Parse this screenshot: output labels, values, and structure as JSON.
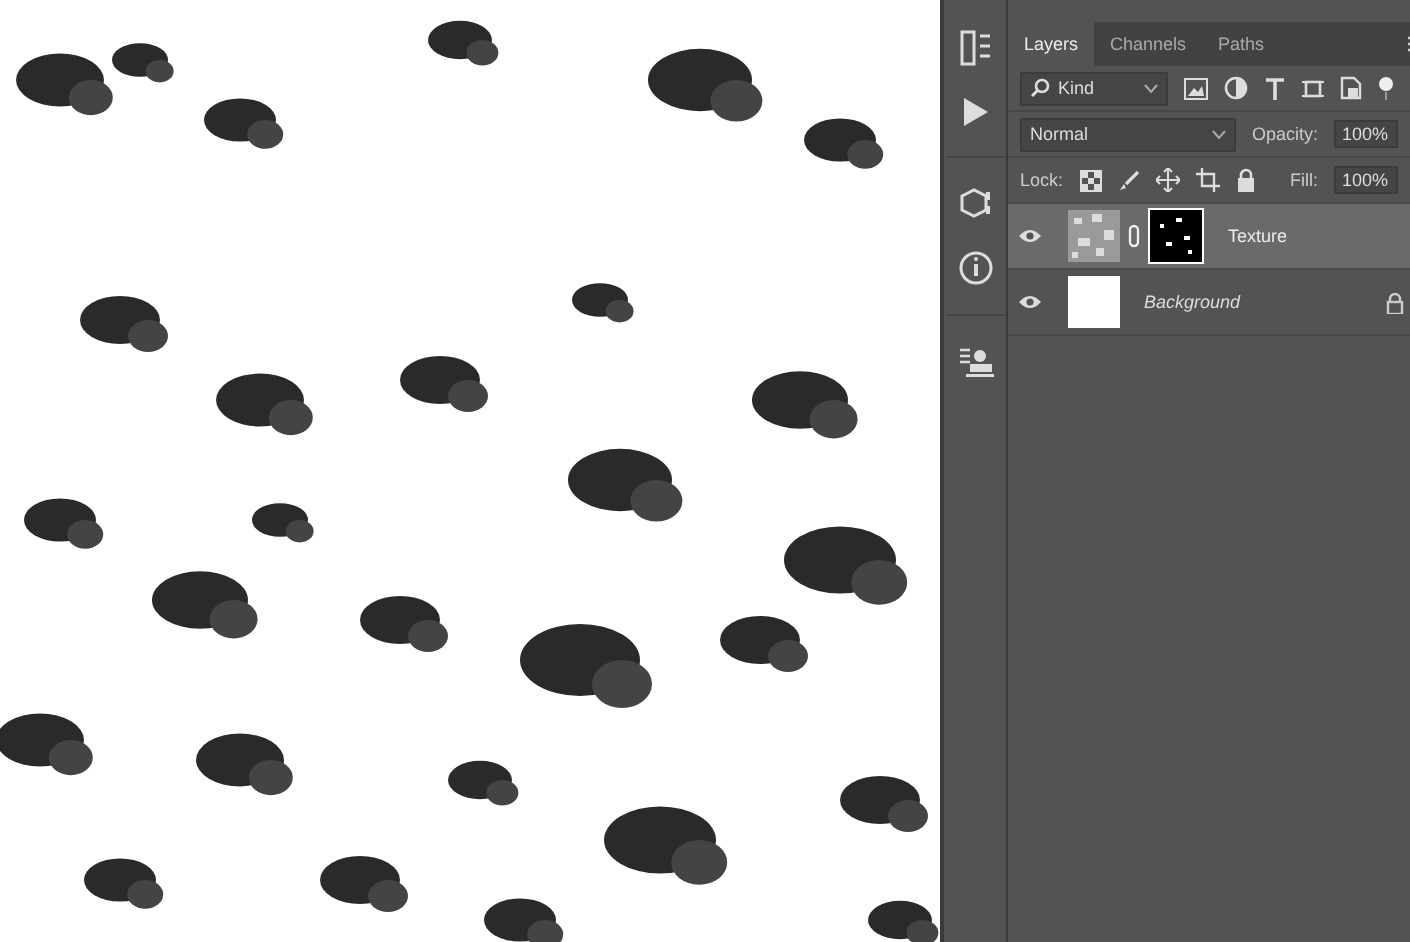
{
  "tabs": [
    {
      "label": "Layers",
      "selected": true
    },
    {
      "label": "Channels",
      "selected": false
    },
    {
      "label": "Paths",
      "selected": false
    }
  ],
  "filter": {
    "value": "Kind"
  },
  "blend_mode": {
    "value": "Normal"
  },
  "opacity": {
    "label": "Opacity:",
    "value": "100%"
  },
  "lock": {
    "label": "Lock:"
  },
  "fill": {
    "label": "Fill:",
    "value": "100%"
  },
  "layers": [
    {
      "name": "Texture",
      "kind": "masked",
      "selected": true,
      "visible": true,
      "locked": false
    },
    {
      "name": "Background",
      "kind": "background",
      "selected": false,
      "visible": true,
      "locked": true
    }
  ]
}
